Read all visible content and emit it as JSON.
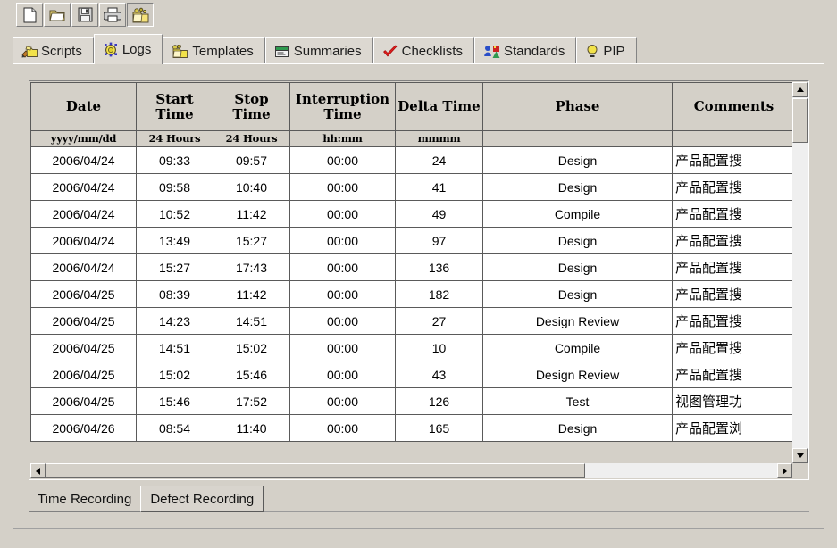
{
  "toolbar": {
    "buttons": [
      {
        "name": "new-document-button",
        "icon": "new-document-icon",
        "label": "New"
      },
      {
        "name": "open-folder-button",
        "icon": "open-folder-icon",
        "label": "Open"
      },
      {
        "name": "save-button",
        "icon": "floppy-disk-icon",
        "label": "Save"
      },
      {
        "name": "print-button",
        "icon": "printer-icon",
        "label": "Print"
      },
      {
        "name": "script-tool-button",
        "icon": "script-folder-icon",
        "label": "Scripts"
      }
    ]
  },
  "tabs": {
    "items": [
      {
        "label": "Scripts",
        "icon": "pencil-folder-icon",
        "selected": false
      },
      {
        "label": "Logs",
        "icon": "clock-bug-icon",
        "selected": true
      },
      {
        "label": "Templates",
        "icon": "template-folder-icon",
        "selected": false
      },
      {
        "label": "Summaries",
        "icon": "report-window-icon",
        "selected": false
      },
      {
        "label": "Checklists",
        "icon": "red-check-icon",
        "selected": false
      },
      {
        "label": "Standards",
        "icon": "people-shapes-icon",
        "selected": false
      },
      {
        "label": "PIP",
        "icon": "lightbulb-icon",
        "selected": false
      }
    ]
  },
  "grid": {
    "columns": [
      {
        "title": "Date",
        "subtitle": "yyyy/mm/dd"
      },
      {
        "title": "Start Time",
        "subtitle": "24 Hours"
      },
      {
        "title": "Stop Time",
        "subtitle": "24 Hours"
      },
      {
        "title": "Interruption Time",
        "subtitle": "hh:mm"
      },
      {
        "title": "Delta Time",
        "subtitle": "mmmm"
      },
      {
        "title": "Phase",
        "subtitle": ""
      },
      {
        "title": "Comments",
        "subtitle": ""
      }
    ],
    "rows": [
      {
        "date": "2006/04/24",
        "start": "09:33",
        "stop": "09:57",
        "interruption": "00:00",
        "delta": "24",
        "phase": "Design",
        "comments": "产品配置搜"
      },
      {
        "date": "2006/04/24",
        "start": "09:58",
        "stop": "10:40",
        "interruption": "00:00",
        "delta": "41",
        "phase": "Design",
        "comments": "产品配置搜"
      },
      {
        "date": "2006/04/24",
        "start": "10:52",
        "stop": "11:42",
        "interruption": "00:00",
        "delta": "49",
        "phase": "Compile",
        "comments": "产品配置搜"
      },
      {
        "date": "2006/04/24",
        "start": "13:49",
        "stop": "15:27",
        "interruption": "00:00",
        "delta": "97",
        "phase": "Design",
        "comments": "产品配置搜"
      },
      {
        "date": "2006/04/24",
        "start": "15:27",
        "stop": "17:43",
        "interruption": "00:00",
        "delta": "136",
        "phase": "Design",
        "comments": "产品配置搜"
      },
      {
        "date": "2006/04/25",
        "start": "08:39",
        "stop": "11:42",
        "interruption": "00:00",
        "delta": "182",
        "phase": "Design",
        "comments": "产品配置搜"
      },
      {
        "date": "2006/04/25",
        "start": "14:23",
        "stop": "14:51",
        "interruption": "00:00",
        "delta": "27",
        "phase": "Design Review",
        "comments": "产品配置搜"
      },
      {
        "date": "2006/04/25",
        "start": "14:51",
        "stop": "15:02",
        "interruption": "00:00",
        "delta": "10",
        "phase": "Compile",
        "comments": "产品配置搜"
      },
      {
        "date": "2006/04/25",
        "start": "15:02",
        "stop": "15:46",
        "interruption": "00:00",
        "delta": "43",
        "phase": "Design Review",
        "comments": "产品配置搜"
      },
      {
        "date": "2006/04/25",
        "start": "15:46",
        "stop": "17:52",
        "interruption": "00:00",
        "delta": "126",
        "phase": "Test",
        "comments": "视图管理功"
      },
      {
        "date": "2006/04/26",
        "start": "08:54",
        "stop": "11:40",
        "interruption": "00:00",
        "delta": "165",
        "phase": "Design",
        "comments": "产品配置浏"
      }
    ]
  },
  "bottom_tabs": {
    "items": [
      {
        "label": "Time Recording",
        "active": true
      },
      {
        "label": "Defect Recording",
        "active": false
      }
    ]
  },
  "colors": {
    "window_bg": "#d4d0c8",
    "header_bg": "#d4d0c8",
    "cell_bg": "#ffffff",
    "accent_yellow": "#f2e24a",
    "accent_red": "#e02020",
    "scroll_track": "#efefef"
  }
}
